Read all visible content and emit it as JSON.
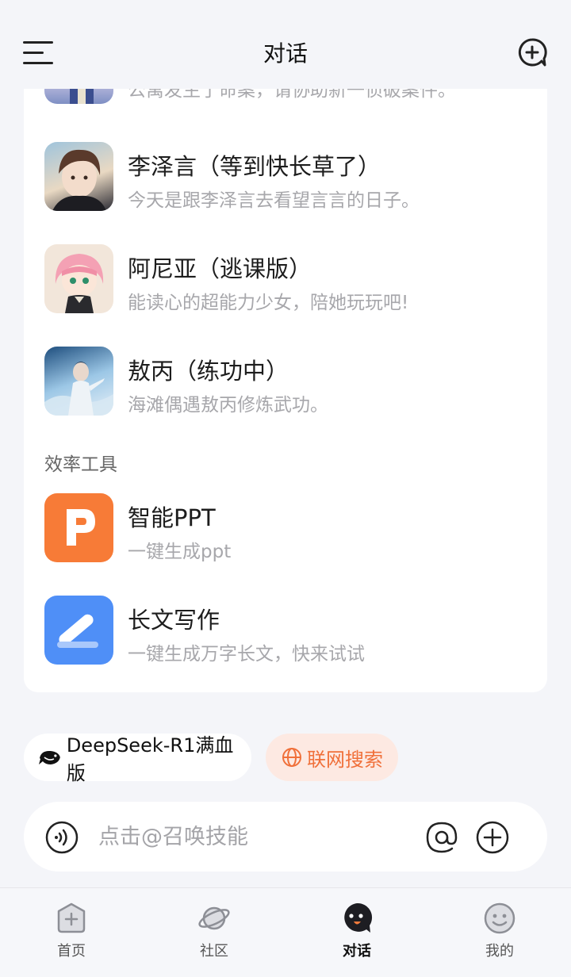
{
  "header": {
    "title": "对话"
  },
  "list": {
    "partial_item": {
      "desc": "公寓发生了命案，请协助新一侦破案件。"
    },
    "items": [
      {
        "name": "李泽言（等到快长草了）",
        "desc": "今天是跟李泽言去看望言言的日子。"
      },
      {
        "name": "阿尼亚（逃课版）",
        "desc": "能读心的超能力少女，陪她玩玩吧!"
      },
      {
        "name": "敖丙（练功中）",
        "desc": "海滩偶遇敖丙修炼武功。"
      }
    ],
    "section_title": "效率工具",
    "tools": [
      {
        "name": "智能PPT",
        "desc": "一键生成ppt"
      },
      {
        "name": "长文写作",
        "desc": "一键生成万字长文，快来试试"
      }
    ]
  },
  "chips": {
    "model": "DeepSeek-R1满血版",
    "search": "联网搜索"
  },
  "input": {
    "placeholder": "点击@召唤技能"
  },
  "tabbar": {
    "tabs": [
      {
        "label": "首页"
      },
      {
        "label": "社区"
      },
      {
        "label": "对话"
      },
      {
        "label": "我的"
      }
    ],
    "active": "对话"
  },
  "colors": {
    "accent": "#f0703a",
    "ppt": "#f77b37",
    "writing": "#4f8ff7"
  }
}
